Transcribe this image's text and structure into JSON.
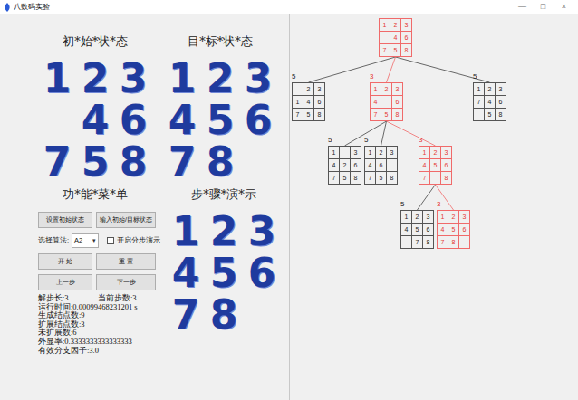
{
  "window": {
    "title": "八数码实验",
    "controls": [
      "—",
      "□",
      "×"
    ]
  },
  "states": {
    "initial": {
      "title": "初*始*状*态",
      "cells": [
        "1",
        "2",
        "3",
        "",
        "4",
        "6",
        "7",
        "5",
        "8"
      ]
    },
    "goal": {
      "title": "目*标*状*态",
      "cells": [
        "1",
        "2",
        "3",
        "4",
        "5",
        "6",
        "7",
        "8",
        ""
      ]
    },
    "demo": {
      "title": "步*骤*演*示",
      "cells": [
        "1",
        "2",
        "3",
        "4",
        "5",
        "6",
        "7",
        "8",
        ""
      ]
    }
  },
  "menu": {
    "title": "功*能*菜*单",
    "buttons_top": [
      "设置初始状态",
      "输入初始/目标状态"
    ],
    "algorithm_label": "选择算法:",
    "algorithm": "A2",
    "dropdown_icon": "▾",
    "step_checkbox": {
      "label": "开启分步演示",
      "checked": false
    },
    "buttons_run": [
      "开 始",
      "重 置"
    ],
    "buttons_step": [
      "上一步",
      "下一步"
    ]
  },
  "stats": {
    "pair": [
      "解步长:3",
      "当前步数:3"
    ],
    "lines": [
      "运行时间:0.00099468231201 s",
      "生成结点数:9",
      "扩展结点数:3",
      "未扩展数:6",
      "外显率:0.3333333333333333",
      "有效分支因子:3.0"
    ]
  },
  "tree": {
    "on_path": true,
    "cells": [
      "1",
      "2",
      "3",
      "",
      "4",
      "6",
      "7",
      "5",
      "8"
    ],
    "children": [
      {
        "label": "5",
        "on_path": false,
        "cells": [
          "",
          "2",
          "3",
          "1",
          "4",
          "6",
          "7",
          "5",
          "8"
        ],
        "children": []
      },
      {
        "label": "3",
        "on_path": true,
        "cells": [
          "1",
          "2",
          "3",
          "4",
          "",
          "6",
          "7",
          "5",
          "8"
        ],
        "children": [
          {
            "label": "5",
            "on_path": false,
            "cells": [
              "1",
              "",
              "3",
              "4",
              "2",
              "6",
              "7",
              "5",
              "8"
            ],
            "children": []
          },
          {
            "label": "5",
            "on_path": false,
            "cells": [
              "1",
              "2",
              "3",
              "4",
              "6",
              "",
              "7",
              "5",
              "8"
            ],
            "children": []
          },
          {
            "label": "3",
            "on_path": true,
            "cells": [
              "1",
              "2",
              "3",
              "4",
              "5",
              "6",
              "7",
              "",
              "8"
            ],
            "children": [
              {
                "label": "5",
                "on_path": false,
                "cells": [
                  "1",
                  "2",
                  "3",
                  "4",
                  "5",
                  "6",
                  "",
                  "7",
                  "8"
                ],
                "children": []
              },
              {
                "label": "3",
                "on_path": true,
                "cells": [
                  "1",
                  "2",
                  "3",
                  "4",
                  "5",
                  "6",
                  "7",
                  "8",
                  ""
                ],
                "children": []
              }
            ]
          }
        ]
      },
      {
        "label": "5",
        "on_path": false,
        "cells": [
          "1",
          "2",
          "3",
          "7",
          "4",
          "6",
          "",
          "5",
          "8"
        ],
        "children": []
      }
    ]
  }
}
